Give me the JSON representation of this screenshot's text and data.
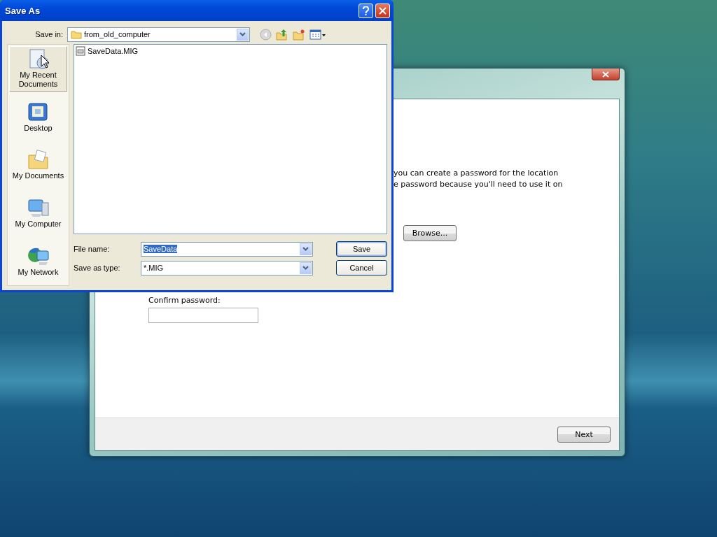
{
  "wizard": {
    "text_lines": [
      "you can create a password for the location",
      "e password because you'll need to use it on"
    ],
    "browse_button": {
      "label": "Browse..."
    },
    "confirm_password": {
      "label": "Confirm password:"
    },
    "next_button": {
      "label": "Next"
    }
  },
  "save_as": {
    "title": "Save As",
    "save_in": {
      "label": "Save in:",
      "value": "from_old_computer"
    },
    "places": [
      {
        "kind": "recent",
        "label": "My Recent Documents",
        "selected": true
      },
      {
        "kind": "desktop",
        "label": "Desktop",
        "selected": false
      },
      {
        "kind": "documents",
        "label": "My Documents",
        "selected": false
      },
      {
        "kind": "computer",
        "label": "My Computer",
        "selected": false
      },
      {
        "kind": "network",
        "label": "My Network",
        "selected": false
      }
    ],
    "files": [
      {
        "name": "SaveData.MIG"
      }
    ],
    "file_name": {
      "label": "File name:",
      "value": "SaveData",
      "text_selected": true
    },
    "save_as_type": {
      "label": "Save as type:",
      "value": "*.MIG"
    },
    "buttons": [
      {
        "label": "Save",
        "default": true
      },
      {
        "label": "Cancel",
        "default": false
      }
    ]
  }
}
